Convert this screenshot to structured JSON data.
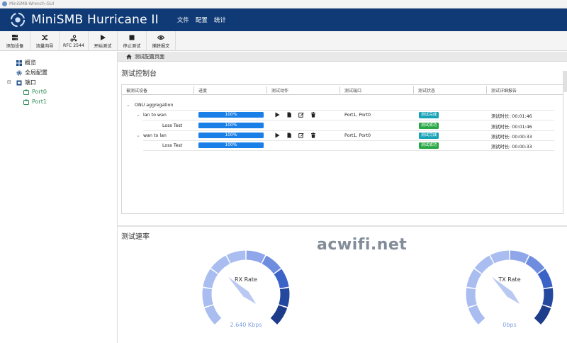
{
  "window": {
    "title": "MiniSMB-Wrench-GUI"
  },
  "app": {
    "title": "MiniSMB Hurricane II",
    "menu": [
      "文件",
      "配置",
      "统计"
    ]
  },
  "toolbar": [
    {
      "label": "添加设备",
      "icon": "server-icon"
    },
    {
      "label": "流量向导",
      "icon": "shuffle-icon"
    },
    {
      "label": "RFC 2544",
      "icon": "flow-icon"
    },
    {
      "label": "开始测试",
      "icon": "play-icon"
    },
    {
      "label": "停止测试",
      "icon": "stop-icon"
    },
    {
      "label": "捕获报文",
      "icon": "eye-icon"
    }
  ],
  "sidebar": {
    "items": [
      {
        "label": "概览",
        "icon": "grid-icon"
      },
      {
        "label": "全局配置",
        "icon": "gear-icon"
      },
      {
        "label": "端口",
        "icon": "port-icon",
        "toggle": "⊟"
      },
      {
        "label": "Port0",
        "icon": "port-icon"
      },
      {
        "label": "Port1",
        "icon": "port-icon"
      }
    ]
  },
  "breadcrumb": {
    "label": "测试配置页面"
  },
  "control": {
    "title": "测试控制台",
    "columns": [
      "被测试设备",
      "进度",
      "测试动作",
      "测试端口",
      "测试状态",
      "测试详细报告"
    ],
    "rows": [
      {
        "name": "ONU aggregation",
        "level": 0,
        "progress": "",
        "actions": false,
        "ports": "",
        "status": "",
        "status_type": "",
        "report": ""
      },
      {
        "name": "lan to wan",
        "level": 1,
        "progress": "100%",
        "actions": true,
        "ports": "Port1, Port0",
        "status": "测试完成",
        "status_type": "info",
        "report": "测试时长: 00:01:46"
      },
      {
        "name": "Loss Test",
        "level": 2,
        "progress": "100%",
        "actions": false,
        "ports": "",
        "status": "测试成功",
        "status_type": "ok",
        "report": "测试时长: 00:01:46"
      },
      {
        "name": "wan to lan",
        "level": 1,
        "progress": "100%",
        "actions": true,
        "ports": "Port1, Port0",
        "status": "测试完成",
        "status_type": "info",
        "report": "测试时长: 00:00:33"
      },
      {
        "name": "Loss Test",
        "level": 2,
        "progress": "100%",
        "actions": false,
        "ports": "",
        "status": "测试成功",
        "status_type": "ok",
        "report": "测试时长: 00:00:33"
      }
    ]
  },
  "rate": {
    "title": "测试速率",
    "gauges": [
      {
        "name": "RX Rate",
        "value": "2.640 Kbps",
        "level": 0.33
      },
      {
        "name": "TX Rate",
        "value": "0bps",
        "level": 0.33
      }
    ]
  },
  "colors": {
    "header": "#0f3a75",
    "progress": "#1a7fe6",
    "status_info": "#17a2b8",
    "status_ok": "#28a745"
  },
  "watermark": "acwifi.net"
}
